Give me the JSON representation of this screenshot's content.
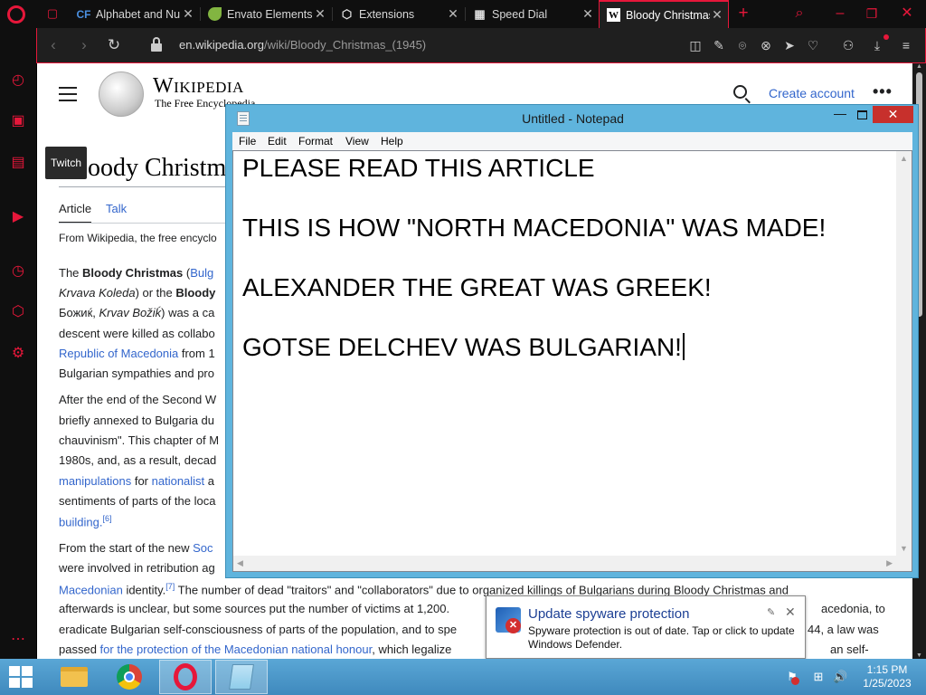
{
  "browser": {
    "tabs": [
      {
        "label": "Alphabet and Nu",
        "favicon": "CF",
        "active": false
      },
      {
        "label": "Envato Elements",
        "favicon": "envato-leaf",
        "active": false
      },
      {
        "label": "Extensions",
        "favicon": "cube",
        "active": false
      },
      {
        "label": "Speed Dial",
        "favicon": "grid",
        "active": false
      },
      {
        "label": "Bloody Christmas",
        "favicon": "W",
        "active": true
      }
    ],
    "url_host": "en.wikipedia.org",
    "url_path": "/wiki/Bloody_Christmas_(1945)",
    "accent_color": "#e6173a",
    "sidebar_tooltip": "Twitch"
  },
  "wiki": {
    "title": "Wikipedia",
    "tagline": "The Free Encyclopedia",
    "create_account": "Create account",
    "article_title_visible": "oody Christm",
    "tab_article": "Article",
    "tab_talk": "Talk",
    "from_line": "From Wikipedia, the free encyclo",
    "lines": {
      "l1_a": "The ",
      "l1_b": "Bloody Christmas",
      "l1_c": " (",
      "l1_d": "Bulg",
      "l2_a": "Krvava Koleda",
      "l2_b": ") or the ",
      "l2_c": "Bloody",
      "l3_a": "Божиќ, ",
      "l3_b": "Krvav Božiḱ",
      "l3_c": ") was a ca",
      "l4": "descent were killed as collabo",
      "l5_a": "Republic of Macedonia",
      "l5_b": " from 1",
      "l6": "Bulgarian sympathies and pro",
      "p2_1": "After the end of the Second W",
      "p2_2": "briefly annexed to Bulgaria du",
      "p2_3": "chauvinism\". This chapter of M",
      "p2_4": "1980s, and, as a result, decad",
      "p2_5_a": "manipulations",
      "p2_5_b": " for ",
      "p2_5_c": "nationalist",
      "p2_5_d": " a",
      "p2_6": "sentiments of parts of the loca",
      "p2_7": "building.",
      "p2_7_ref": "[6]",
      "p3_1_a": "From the start of the new ",
      "p3_1_b": "Soc",
      "p3_2": "were involved in retribution ag",
      "p3_3_a": "Macedonian",
      "p3_3_b": " identity.",
      "p3_3_ref": "[7]",
      "p3_3_c": " The number of dead \"traitors\" and \"collaborators\" due to organized killings of Bulgarians during Bloody Christmas and",
      "p3_4_a": "afterwards is unclear, but some sources put the number of victims at 1,200.",
      "p3_4_b": "acedonia, to",
      "p3_5_a": "eradicate Bulgarian self-consciousness of parts of the population, and to spe",
      "p3_5_b": "44, a law was",
      "p3_6_a": "passed ",
      "p3_6_b": "for the protection of the Macedonian national honour",
      "p3_6_c": ", which legalize",
      "p3_6_d": "an self-"
    }
  },
  "notepad": {
    "title": "Untitled - Notepad",
    "menu": [
      "File",
      "Edit",
      "Format",
      "View",
      "Help"
    ],
    "content": "PLEASE READ THIS ARTICLE\n\nTHIS IS HOW \"NORTH MACEDONIA\" WAS MADE!\n\nALEXANDER THE GREAT WAS GREEK!\n\nGOTSE DELCHEV WAS BULGARIAN!"
  },
  "notification": {
    "title": "Update spyware protection",
    "body": "Spyware protection is out of date. Tap or click to update Windows Defender."
  },
  "taskbar": {
    "apps": [
      "file-explorer",
      "chrome",
      "opera",
      "notepad"
    ],
    "time": "1:15 PM",
    "date": "1/25/2023",
    "color": "#4a96c8"
  }
}
